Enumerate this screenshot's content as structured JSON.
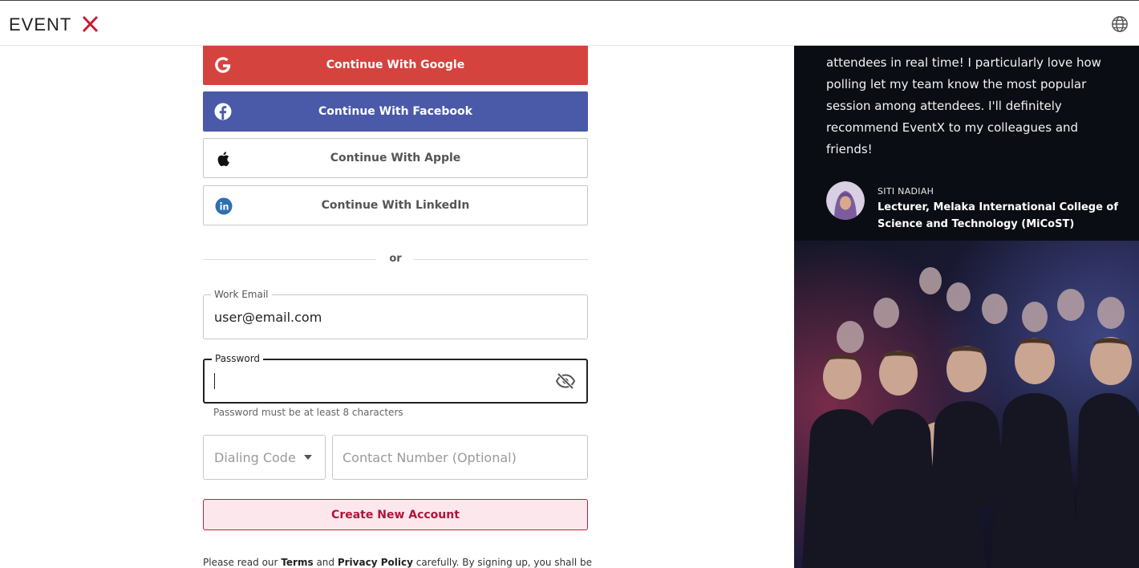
{
  "header": {
    "logo_text": "EVENTX",
    "logo_icon": "eventx-logo",
    "language_icon": "globe-icon"
  },
  "social": {
    "google": {
      "label": "Continue With Google",
      "icon": "google-icon",
      "color": "#d5433f"
    },
    "facebook": {
      "label": "Continue With Facebook",
      "icon": "facebook-icon",
      "color": "#4a5aa8"
    },
    "apple": {
      "label": "Continue With Apple",
      "icon": "apple-icon"
    },
    "linkedin": {
      "label": "Continue With LinkedIn",
      "icon": "linkedin-icon"
    }
  },
  "divider_text": "or",
  "form": {
    "email": {
      "label": "Work Email",
      "value": "user@email.com"
    },
    "password": {
      "label": "Password",
      "value": "",
      "helper": "Password must be at least 8 characters",
      "toggle_icon": "eye-off-icon"
    },
    "dialing_code": {
      "placeholder": "Dialing Code",
      "icon": "chevron-down-icon"
    },
    "contact": {
      "placeholder": "Contact Number (Optional)"
    },
    "submit_label": "Create New Account",
    "accent_color": "#c41e3a"
  },
  "terms": {
    "prefix": "Please read our",
    "terms_link": "Terms",
    "and": "and",
    "privacy_link": "Privacy Policy",
    "suffix": "carefully. By signing up, you shall be"
  },
  "testimonial": {
    "quote": "attendees in real time! I particularly love how polling let my team know the most popular session among attendees. I'll definitely recommend EventX to my colleagues and friends!",
    "author_name": "SITI NADIAH",
    "author_title": "Lecturer, Melaka International College of Science and Technology (MiCoST)"
  }
}
